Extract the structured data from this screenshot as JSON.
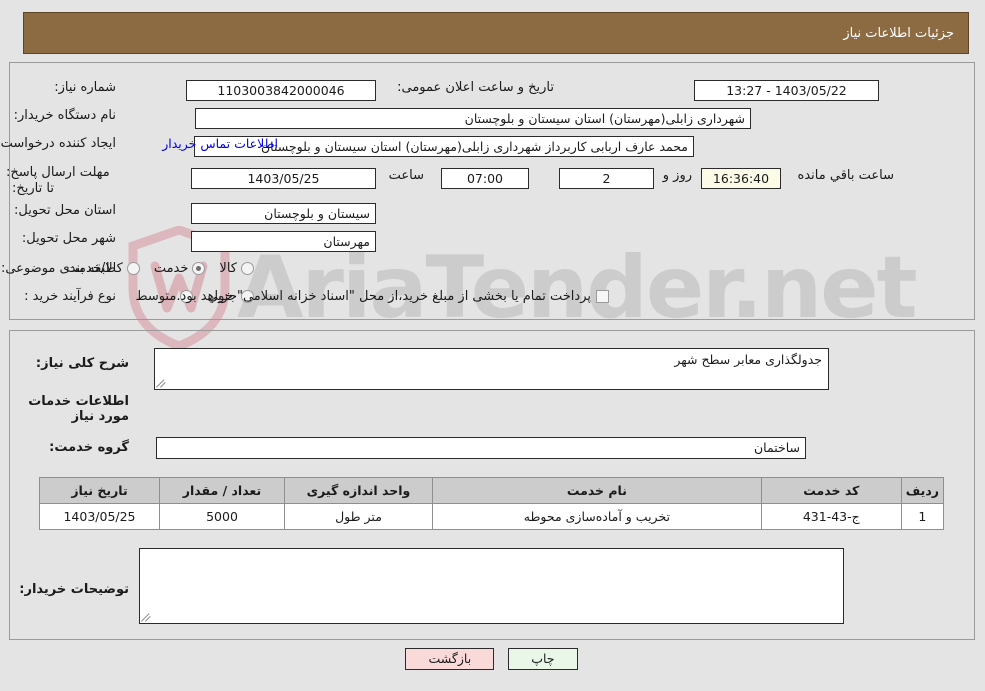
{
  "header": {
    "title": "جزئیات اطلاعات نیاز"
  },
  "watermark": {
    "text": "AriaTender.net"
  },
  "form": {
    "need_number_label": "شماره نیاز:",
    "need_number_value": "1103003842000046",
    "announce_label": "تاریخ و ساعت اعلان عمومی:",
    "announce_value": "1403/05/22 - 13:27",
    "buyer_org_label": "نام دستگاه خریدار:",
    "buyer_org_value": "شهرداری زابلی(مهرستان) استان سیستان و بلوچستان",
    "creator_label": "ایجاد کننده درخواست:",
    "creator_value": "محمد عارف اربابی کاربرداز شهرداری زابلی(مهرستان) استان سیستان و بلوچستان",
    "contact_link": "اطلاعات تماس خریدار",
    "deadline_label": "مهلت ارسال پاسخ: تا تاریخ:",
    "deadline_date": "1403/05/25",
    "hour_label": "ساعت",
    "deadline_time": "07:00",
    "days_value": "2",
    "days_label": "روز و",
    "countdown_value": "16:36:40",
    "countdown_label": "ساعت باقي مانده",
    "province_label": "استان محل تحویل:",
    "province_value": "سیستان و بلوچستان",
    "city_label": "شهر محل تحویل:",
    "city_value": "مهرستان",
    "category_label": "طبقه بندی موضوعی:",
    "category_options": [
      {
        "label": "کالا",
        "checked": false
      },
      {
        "label": "خدمت",
        "checked": true
      },
      {
        "label": "کالا/خدمت",
        "checked": false
      }
    ],
    "process_label": "نوع فرآیند خرید :",
    "process_options": [
      {
        "label": "جزیي",
        "checked": false
      },
      {
        "label": "متوسط",
        "checked": false
      }
    ],
    "treasury_checkbox_checked": false,
    "treasury_text": "پرداخت تمام یا بخشی از مبلغ خرید،از محل \"اسناد خزانه اسلامی\" خواهد بود."
  },
  "summary": {
    "label": "شرح کلی نیاز:",
    "value": "جدولگذاری معابر سطح شهر"
  },
  "services_section": {
    "heading": "اطلاعات خدمات مورد نیاز",
    "group_label": "گروه خدمت:",
    "group_value": "ساختمان"
  },
  "table": {
    "headers": [
      "ردیف",
      "کد خدمت",
      "نام خدمت",
      "واحد اندازه گیری",
      "تعداد / مقدار",
      "تاریخ نیاز"
    ],
    "rows": [
      {
        "row": "1",
        "code": "ج-43-431",
        "name": "تخریب و آماده‌سازی محوطه",
        "unit": "متر طول",
        "qty": "5000",
        "date": "1403/05/25"
      }
    ]
  },
  "buyer_notes": {
    "label": "توضیحات خریدار:",
    "value": ""
  },
  "footer": {
    "print_label": "چاپ",
    "back_label": "بازگشت"
  },
  "colors": {
    "header_bg": "#8c6b43",
    "link": "#0000e0",
    "page_bg": "#e4e4e4",
    "table_header_bg": "#cccccc",
    "print_btn_bg": "#e8f7e8",
    "back_btn_bg": "#fad9d9",
    "timer_bg": "#fbfbe8"
  }
}
